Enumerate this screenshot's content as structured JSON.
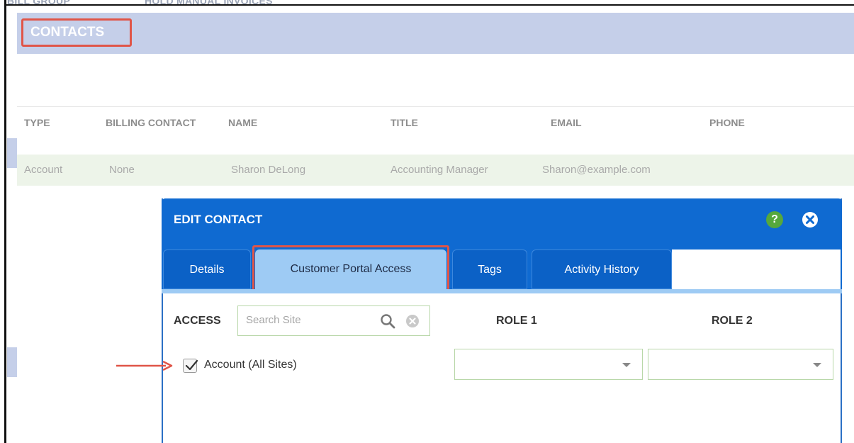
{
  "page_cut_text": [
    "BILL GROUP",
    "HOLD MANUAL INVOICES"
  ],
  "contacts": {
    "title": "CONTACTS"
  },
  "table": {
    "headers": [
      "TYPE",
      "BILLING CONTACT",
      "NAME",
      "TITLE",
      "EMAIL",
      "PHONE"
    ],
    "row": {
      "type": "Account",
      "billing_contact": "None",
      "name": "Sharon DeLong",
      "title": "Accounting Manager",
      "email": "Sharon@example.com",
      "phone": ""
    }
  },
  "modal": {
    "title": "EDIT CONTACT",
    "help_glyph": "?",
    "tabs": [
      {
        "label": "Details",
        "active": false
      },
      {
        "label": "Customer Portal Access",
        "active": true
      },
      {
        "label": "Tags",
        "active": false
      },
      {
        "label": "Activity History",
        "active": false
      }
    ],
    "access_label": "ACCESS",
    "search_placeholder": "Search Site",
    "role1_label": "ROLE 1",
    "role2_label": "ROLE 2",
    "account_checkbox_label": "Account (All Sites)",
    "account_checked": true,
    "role1_value": "",
    "role2_value": ""
  },
  "colors": {
    "header_blue": "#0f6ad1",
    "active_tab": "#9ecbf4",
    "contacts_bar": "#c5cfe9",
    "highlight_red": "#e05548",
    "help_green": "#56a83c"
  },
  "icons": [
    "help-icon",
    "close-icon",
    "search-icon",
    "clear-icon",
    "checkmark-icon",
    "annotation-arrow-icon",
    "dropdown-caret-icon"
  ]
}
